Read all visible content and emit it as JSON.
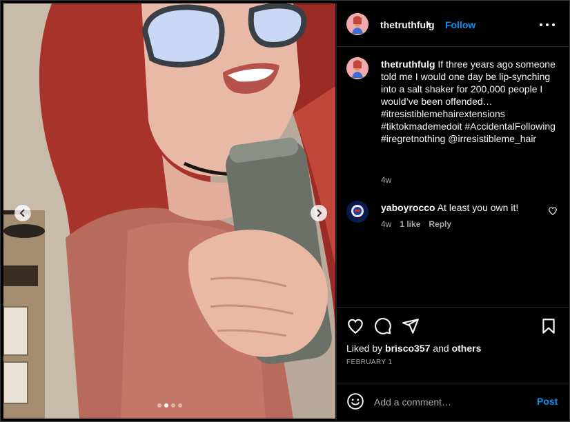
{
  "post": {
    "username": "thetruthfulg",
    "follow_label": "Follow",
    "separator": "•"
  },
  "caption": {
    "username": "thetruthfulg",
    "text": "If three years ago someone told me I would one day be lip-synching into a salt shaker for 200,000 people I would’ve been offended… #itresistiblemehairextensions #tiktokmademedoit #AccidentalFollowing #iregretnothing @irresistibleme_hair",
    "time": "4w"
  },
  "comment": {
    "username": "yaboyrocco",
    "text": "At least you own it!",
    "time": "4w",
    "likes": "1 like",
    "reply_label": "Reply"
  },
  "likes": {
    "prefix": "Liked by",
    "user": "brisco357",
    "middle": "and",
    "suffix": "others"
  },
  "date": "FEBRUARY 1",
  "add_comment": {
    "placeholder": "Add a comment…",
    "post_label": "Post"
  },
  "carousel": {
    "slide_count": 4,
    "active_index": 1
  },
  "colors": {
    "accent": "#0095f6",
    "background": "#000000",
    "muted": "#a8a8a8"
  }
}
